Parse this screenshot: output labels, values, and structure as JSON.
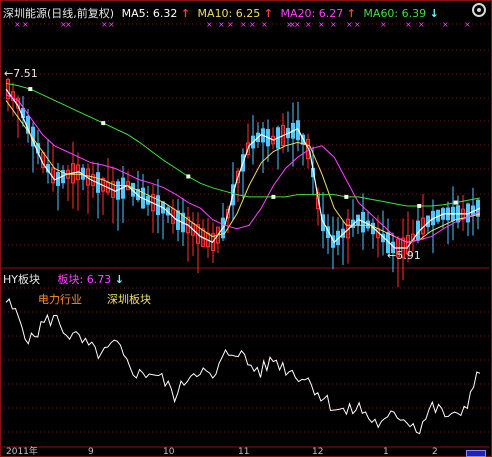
{
  "header": {
    "stock": "深圳能源(日线,前复权)",
    "ma5_label": "MA5:",
    "ma5_value": "6.32",
    "ma5_dir": "↑",
    "ma10_label": "MA10:",
    "ma10_value": "6.25",
    "ma10_dir": "↑",
    "ma20_label": "MA20:",
    "ma20_value": "6.27",
    "ma20_dir": "↑",
    "ma60_label": "MA60:",
    "ma60_value": "6.39",
    "ma60_dir": "↓"
  },
  "annotations": {
    "high": "7.51",
    "low": "5.91"
  },
  "sub_panel": {
    "indicator": "HY板块",
    "board_label": "板块:",
    "board_value": "6.73",
    "board_dir": "↓",
    "legend_sector": "电力行业",
    "legend_region": "深圳板块"
  },
  "date_axis": {
    "year_label": "2011年",
    "ticks": [
      "9",
      "10",
      "11",
      "12",
      "1",
      "2"
    ]
  },
  "colors": {
    "ma5": "#ffffff",
    "ma10": "#f0e060",
    "ma20": "#ff40ff",
    "ma60": "#40e040",
    "up": "#ff3030",
    "down": "#50c8ff",
    "grid": "#8a1010",
    "legend_sector": "#ff8c30",
    "legend_region": "#f0e060"
  },
  "chart_data": [
    {
      "type": "line",
      "title": "深圳能源(日线,前复权)",
      "series": [
        {
          "name": "MA5",
          "values": [
            7.35,
            7.2,
            6.95,
            6.7,
            6.55,
            6.6,
            6.62,
            6.55,
            6.5,
            6.45,
            6.5,
            6.4,
            6.35,
            6.3,
            6.2,
            6.15,
            6.05,
            6.0,
            6.15,
            6.55,
            6.85,
            6.95,
            6.9,
            6.95,
            7.0,
            6.8,
            6.2,
            6.0,
            6.1,
            6.2,
            6.15,
            6.05,
            5.95,
            5.95,
            6.1,
            6.2,
            6.25,
            6.25,
            6.25,
            6.3
          ]
        },
        {
          "name": "MA10",
          "values": [
            7.25,
            7.1,
            6.95,
            6.8,
            6.65,
            6.6,
            6.6,
            6.58,
            6.55,
            6.5,
            6.5,
            6.45,
            6.4,
            6.35,
            6.28,
            6.2,
            6.12,
            6.05,
            6.08,
            6.25,
            6.5,
            6.7,
            6.8,
            6.85,
            6.88,
            6.85,
            6.6,
            6.3,
            6.15,
            6.15,
            6.15,
            6.1,
            6.05,
            6.0,
            6.02,
            6.1,
            6.15,
            6.2,
            6.22,
            6.25
          ]
        },
        {
          "name": "MA20",
          "values": [
            7.3,
            7.25,
            7.1,
            6.95,
            6.85,
            6.8,
            6.75,
            6.7,
            6.68,
            6.65,
            6.6,
            6.55,
            6.52,
            6.48,
            6.42,
            6.35,
            6.3,
            6.2,
            6.15,
            6.12,
            6.15,
            6.3,
            6.5,
            6.65,
            6.75,
            6.82,
            6.85,
            6.75,
            6.55,
            6.35,
            6.25,
            6.15,
            6.05,
            6.0,
            6.02,
            6.05,
            6.12,
            6.18,
            6.22,
            6.27
          ]
        },
        {
          "name": "MA60",
          "values": [
            7.4,
            7.38,
            7.35,
            7.3,
            7.25,
            7.2,
            7.15,
            7.1,
            7.05,
            7.0,
            6.95,
            6.88,
            6.8,
            6.72,
            6.65,
            6.58,
            6.52,
            6.48,
            6.45,
            6.42,
            6.4,
            6.4,
            6.4,
            6.4,
            6.42,
            6.42,
            6.42,
            6.42,
            6.4,
            6.4,
            6.38,
            6.36,
            6.34,
            6.32,
            6.32,
            6.32,
            6.33,
            6.35,
            6.37,
            6.39
          ]
        }
      ],
      "annotations": {
        "high": 7.51,
        "low": 5.91
      }
    },
    {
      "type": "line",
      "title": "HY板块",
      "series": [
        {
          "name": "板块",
          "values": [
            6.95,
            6.9,
            6.82,
            6.88,
            6.9,
            6.85,
            6.83,
            6.8,
            6.78,
            6.82,
            6.75,
            6.72,
            6.73,
            6.7,
            6.65,
            6.72,
            6.74,
            6.7,
            6.78,
            6.8,
            6.75,
            6.73,
            6.77,
            6.74,
            6.72,
            6.7,
            6.65,
            6.62,
            6.6,
            6.62,
            6.58,
            6.56,
            6.6,
            6.58,
            6.55,
            6.62,
            6.6,
            6.58,
            6.64,
            6.73
          ]
        }
      ]
    }
  ]
}
